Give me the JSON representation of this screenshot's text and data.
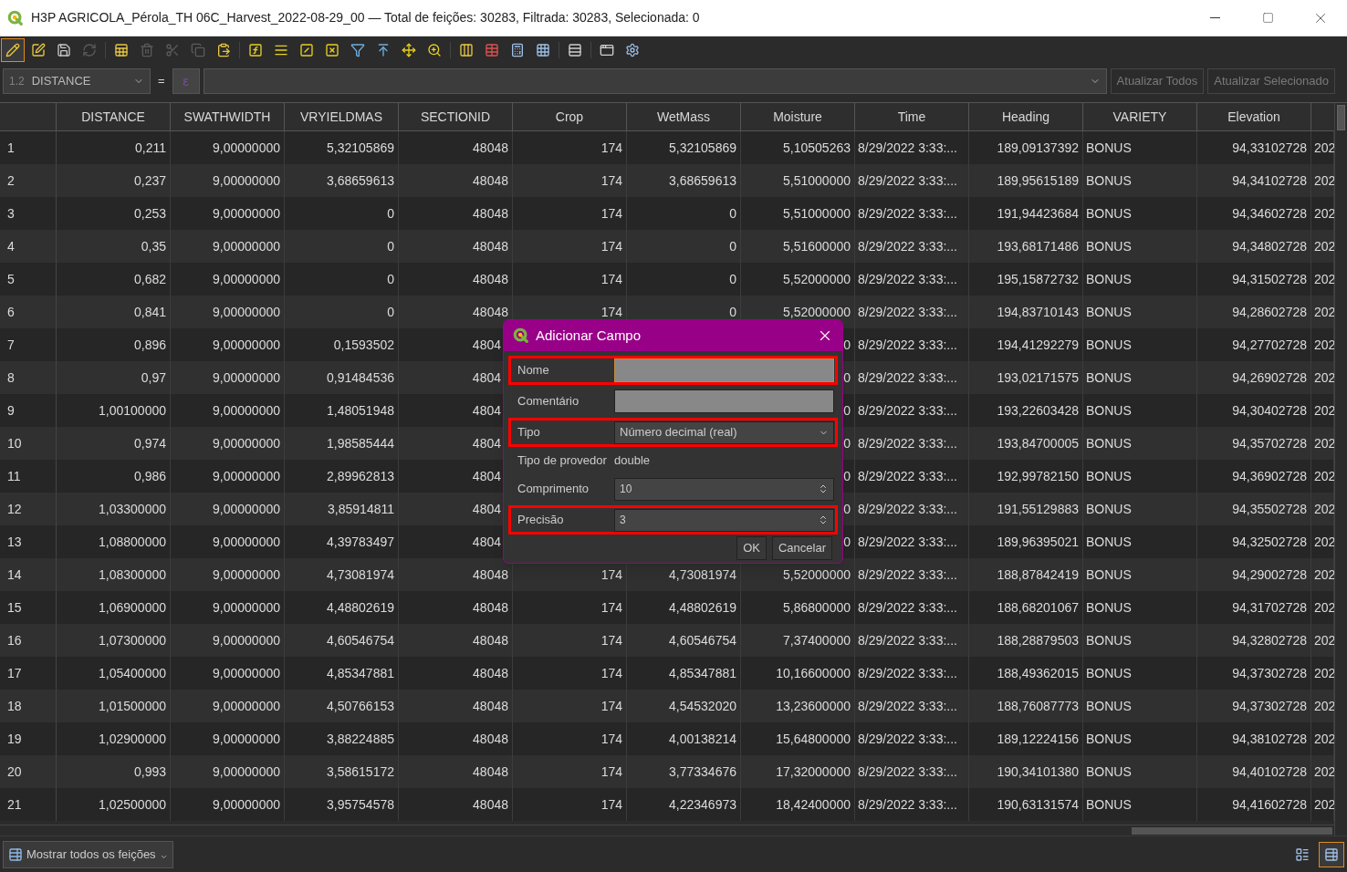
{
  "window": {
    "title": "H3P AGRICOLA_Pérola_TH 06C_Harvest_2022-08-29_00 — Total de feições: 30283, Filtrada: 30283, Selecionada: 0"
  },
  "toolbar": [
    {
      "selected": true,
      "disabled": false
    },
    {
      "selected": false,
      "disabled": false
    },
    {
      "selected": false,
      "disabled": false
    },
    {
      "selected": false,
      "disabled": true
    },
    {
      "selected": false,
      "disabled": false
    },
    {
      "selected": false,
      "disabled": true
    },
    {
      "selected": false,
      "disabled": true
    },
    {
      "selected": false,
      "disabled": true
    },
    {
      "selected": false,
      "disabled": false
    },
    {
      "selected": false,
      "disabled": false
    },
    {
      "selected": false,
      "disabled": false
    },
    {
      "selected": false,
      "disabled": false
    },
    {
      "selected": false,
      "disabled": false
    },
    {
      "selected": false,
      "disabled": false
    },
    {
      "selected": false,
      "disabled": false
    },
    {
      "selected": false,
      "disabled": false
    },
    {
      "selected": false,
      "disabled": false
    },
    {
      "selected": false,
      "disabled": false
    },
    {
      "selected": false,
      "disabled": false
    },
    {
      "selected": false,
      "disabled": false
    },
    {
      "selected": false,
      "disabled": false
    },
    {
      "selected": false,
      "disabled": false
    },
    {
      "selected": false,
      "disabled": false
    },
    {
      "selected": false,
      "disabled": false
    }
  ],
  "filter_bar": {
    "field_type": "1.2",
    "field": "DISTANCE",
    "operator": "=",
    "expression_button": "ε",
    "buttons": [
      {
        "label": "Atualizar Todos",
        "disabled": true
      },
      {
        "label": "Atualizar Selecionado",
        "disabled": true
      }
    ]
  },
  "table": {
    "columns": [
      "DISTANCE",
      "SWATHWIDTH",
      "VRYIELDMAS",
      "SECTIONID",
      "Crop",
      "WetMass",
      "Moisture",
      "Time",
      "Heading",
      "VARIETY",
      "Elevation",
      null
    ],
    "rows": [
      {
        "id": "1",
        "cells": [
          "0,211",
          "9,00000000",
          "5,32105869",
          "48048",
          "174",
          "5,32105869",
          "5,10505263",
          "8/29/2022 3:33:...",
          "189,09137392",
          "BONUS",
          "94,33102728",
          "202"
        ]
      },
      {
        "id": "2",
        "cells": [
          "0,237",
          "9,00000000",
          "3,68659613",
          "48048",
          "174",
          "3,68659613",
          "5,51000000",
          "8/29/2022 3:33:...",
          "189,95615189",
          "BONUS",
          "94,34102728",
          "202"
        ]
      },
      {
        "id": "3",
        "cells": [
          "0,253",
          "9,00000000",
          "0",
          "48048",
          "174",
          "0",
          "5,51000000",
          "8/29/2022 3:33:...",
          "191,94423684",
          "BONUS",
          "94,34602728",
          "202"
        ]
      },
      {
        "id": "4",
        "cells": [
          "0,35",
          "9,00000000",
          "0",
          "48048",
          "174",
          "0",
          "5,51600000",
          "8/29/2022 3:33:...",
          "193,68171486",
          "BONUS",
          "94,34802728",
          "202"
        ]
      },
      {
        "id": "5",
        "cells": [
          "0,682",
          "9,00000000",
          "0",
          "48048",
          "174",
          "0",
          "5,52000000",
          "8/29/2022 3:33:...",
          "195,15872732",
          "BONUS",
          "94,31502728",
          "202"
        ]
      },
      {
        "id": "6",
        "cells": [
          "0,841",
          "9,00000000",
          "0",
          "48048",
          "174",
          "0",
          "5,52000000",
          "8/29/2022 3:33:...",
          "194,83710143",
          "BONUS",
          "94,28602728",
          "202"
        ]
      },
      {
        "id": "7",
        "cells": [
          "0,896",
          "9,00000000",
          "0,1593502",
          "4804",
          null,
          null,
          "0",
          "8/29/2022 3:33:...",
          "194,41292279",
          "BONUS",
          "94,27702728",
          "202"
        ]
      },
      {
        "id": "8",
        "cells": [
          "0,97",
          "9,00000000",
          "0,91484536",
          "4804",
          null,
          null,
          "0",
          "8/29/2022 3:33:...",
          "193,02171575",
          "BONUS",
          "94,26902728",
          "202"
        ]
      },
      {
        "id": "9",
        "cells": [
          "1,00100000",
          "9,00000000",
          "1,48051948",
          "4804",
          null,
          null,
          "0",
          "8/29/2022 3:33:...",
          "193,22603428",
          "BONUS",
          "94,30402728",
          "202"
        ]
      },
      {
        "id": "10",
        "cells": [
          "0,974",
          "9,00000000",
          "1,98585444",
          "4804",
          null,
          null,
          "0",
          "8/29/2022 3:33:...",
          "193,84700005",
          "BONUS",
          "94,35702728",
          "202"
        ]
      },
      {
        "id": "11",
        "cells": [
          "0,986",
          "9,00000000",
          "2,89962813",
          "4804",
          null,
          null,
          "0",
          "8/29/2022 3:33:...",
          "192,99782150",
          "BONUS",
          "94,36902728",
          "202"
        ]
      },
      {
        "id": "12",
        "cells": [
          "1,03300000",
          "9,00000000",
          "3,85914811",
          "4804",
          null,
          null,
          "0",
          "8/29/2022 3:33:...",
          "191,55129883",
          "BONUS",
          "94,35502728",
          "202"
        ]
      },
      {
        "id": "13",
        "cells": [
          "1,08800000",
          "9,00000000",
          "4,39783497",
          "4804",
          null,
          null,
          "0",
          "8/29/2022 3:33:...",
          "189,96395021",
          "BONUS",
          "94,32502728",
          "202"
        ]
      },
      {
        "id": "14",
        "cells": [
          "1,08300000",
          "9,00000000",
          "4,73081974",
          "48048",
          "174",
          "4,73081974",
          "5,52000000",
          "8/29/2022 3:33:...",
          "188,87842419",
          "BONUS",
          "94,29002728",
          "202"
        ]
      },
      {
        "id": "15",
        "cells": [
          "1,06900000",
          "9,00000000",
          "4,48802619",
          "48048",
          "174",
          "4,48802619",
          "5,86800000",
          "8/29/2022 3:33:...",
          "188,68201067",
          "BONUS",
          "94,31702728",
          "202"
        ]
      },
      {
        "id": "16",
        "cells": [
          "1,07300000",
          "9,00000000",
          "4,60546754",
          "48048",
          "174",
          "4,60546754",
          "7,37400000",
          "8/29/2022 3:33:...",
          "188,28879503",
          "BONUS",
          "94,32802728",
          "202"
        ]
      },
      {
        "id": "17",
        "cells": [
          "1,05400000",
          "9,00000000",
          "4,85347881",
          "48048",
          "174",
          "4,85347881",
          "10,16600000",
          "8/29/2022 3:33:...",
          "188,49362015",
          "BONUS",
          "94,37302728",
          "202"
        ]
      },
      {
        "id": "18",
        "cells": [
          "1,01500000",
          "9,00000000",
          "4,50766153",
          "48048",
          "174",
          "4,54532020",
          "13,23600000",
          "8/29/2022 3:33:...",
          "188,76087773",
          "BONUS",
          "94,37302728",
          "202"
        ]
      },
      {
        "id": "19",
        "cells": [
          "1,02900000",
          "9,00000000",
          "3,88224885",
          "48048",
          "174",
          "4,00138214",
          "15,64800000",
          "8/29/2022 3:33:...",
          "189,12224156",
          "BONUS",
          "94,38102728",
          "202"
        ]
      },
      {
        "id": "20",
        "cells": [
          "0,993",
          "9,00000000",
          "3,58615172",
          "48048",
          "174",
          "3,77334676",
          "17,32000000",
          "8/29/2022 3:33:...",
          "190,34101380",
          "BONUS",
          "94,40102728",
          "202"
        ]
      },
      {
        "id": "21",
        "cells": [
          "1,02500000",
          "9,00000000",
          "3,95754578",
          "48048",
          "174",
          "4,22346973",
          "18,42400000",
          "8/29/2022 3:33:...",
          "190,63131574",
          "BONUS",
          "94,41602728",
          "202"
        ]
      }
    ]
  },
  "dialog": {
    "title": "Adicionar Campo",
    "fields": [
      {
        "kind": "text",
        "label": "Nome",
        "highlighted": true,
        "focused": true
      },
      {
        "kind": "text",
        "label": "Comentário",
        "highlighted": false,
        "focused": false
      },
      {
        "kind": "combo",
        "label": "Tipo",
        "value": "Número decimal (real)",
        "highlighted": true
      },
      {
        "kind": "info",
        "label": "Tipo de provedor",
        "value": "double",
        "highlighted": false
      },
      {
        "kind": "spin",
        "label": "Comprimento",
        "value": "10",
        "highlighted": false
      },
      {
        "kind": "spin",
        "label": "Precisão",
        "value": "3",
        "highlighted": true
      }
    ],
    "buttons": [
      "OK",
      "Cancelar"
    ]
  },
  "status_bar": {
    "filter_button": "Mostrar todos os feições",
    "views": [
      {
        "selected": false
      },
      {
        "selected": true
      }
    ]
  }
}
